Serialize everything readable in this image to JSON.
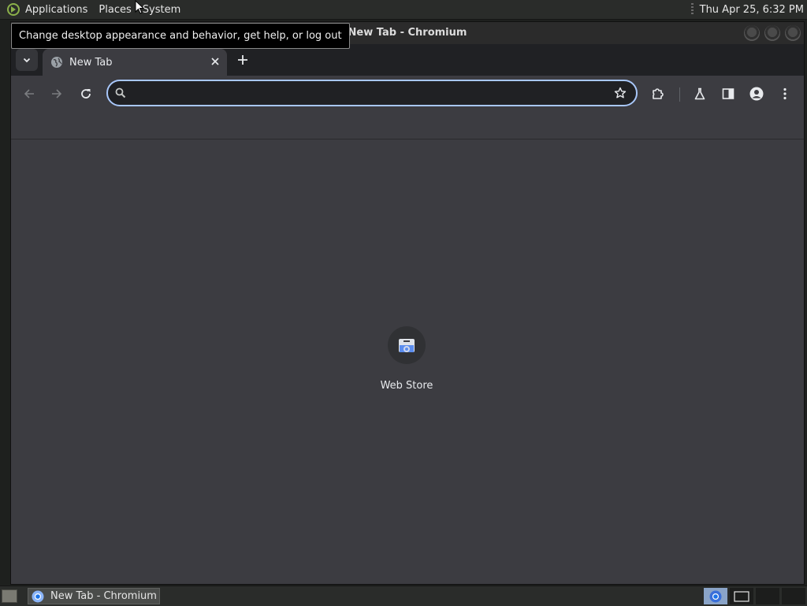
{
  "top_panel": {
    "menus": {
      "applications": "Applications",
      "places": "Places",
      "system": "System"
    },
    "clock": "Thu Apr 25,  6:32 PM"
  },
  "tooltip": {
    "text": "Change desktop appearance and behavior, get help, or log out"
  },
  "window": {
    "title": "New Tab - Chromium",
    "tab": {
      "title": "New Tab",
      "close_icon": "close-icon",
      "favicon": "globe-icon"
    },
    "new_tab_icon": "plus-icon",
    "toolbar": {
      "back_icon": "arrow-left-icon",
      "forward_icon": "arrow-right-icon",
      "reload_icon": "reload-icon",
      "omnibox": {
        "value": "",
        "placeholder": ""
      },
      "bookmark_icon": "star-icon",
      "extensions_icon": "puzzle-icon",
      "labs_icon": "flask-icon",
      "side_panel_icon": "side-panel-icon",
      "profile_icon": "person-icon",
      "menu_icon": "kebab-menu-icon"
    },
    "shortcuts": [
      {
        "label": "Web Store",
        "icon": "web-store-icon"
      }
    ]
  },
  "taskbar": {
    "items": [
      {
        "label": "New Tab - Chromium",
        "icon": "chromium-icon"
      }
    ],
    "workspaces": 4
  },
  "colors": {
    "accent": "#a8c7fa",
    "page_bg": "#3c3c41",
    "tabstrip_bg": "#202124"
  }
}
